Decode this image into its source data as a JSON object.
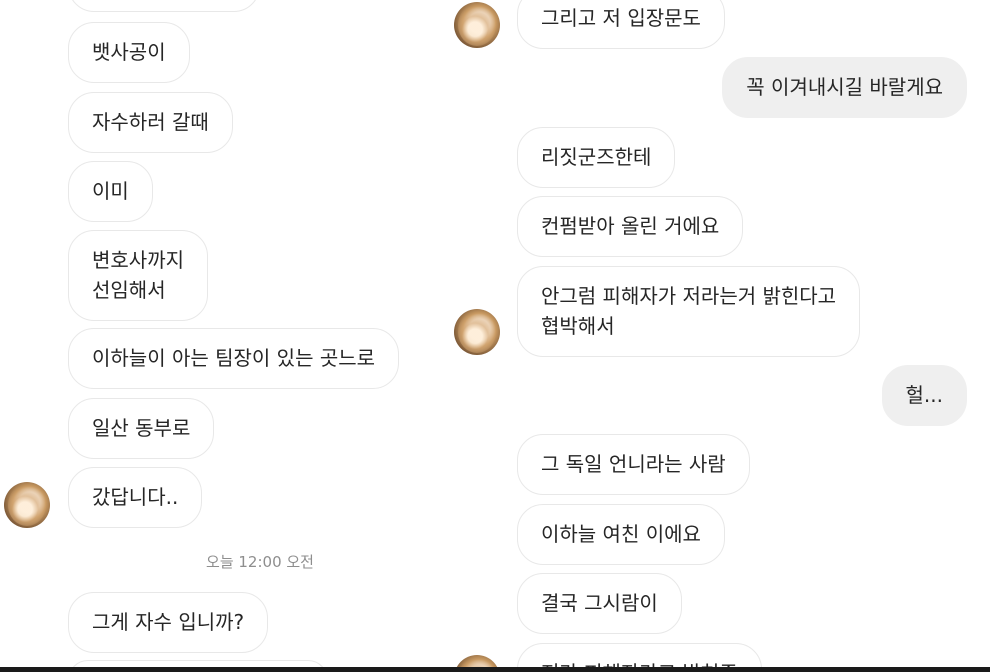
{
  "left_thread": {
    "messages": [
      {
        "text": "뱃사공이"
      },
      {
        "text": "자수하러 갈때"
      },
      {
        "text": "이미"
      },
      {
        "text": "변호사까지 선임해서",
        "line1": "변호사까지",
        "line2": "선임해서"
      },
      {
        "text": "이하늘이 아는 팀장이 있는 곳느로"
      },
      {
        "text": "일산 동부로"
      },
      {
        "text": "갔답니다.."
      },
      {
        "text": "그게 자수 입니까?"
      }
    ],
    "timestamp": "오늘 12:00 오전"
  },
  "right_thread": {
    "messages": [
      {
        "text": "그리고 저 입장문도",
        "direction": "received"
      },
      {
        "text": "꼭 이겨내시길 바랄게요",
        "direction": "sent"
      },
      {
        "text": "리짓군즈한테",
        "direction": "received"
      },
      {
        "text": "컨펌받아 올린 거에요",
        "direction": "received"
      },
      {
        "text": "안그럼 피해자가 저라는거 밝힌다고 협박해서",
        "line1": "안그럼 피해자가 저라는거 밝힌다고",
        "line2": "협박해서",
        "direction": "received"
      },
      {
        "text": "헐...",
        "direction": "sent"
      },
      {
        "text": "그 독일 언니라는 사람",
        "direction": "received"
      },
      {
        "text": "이하늘 여친 이에요",
        "direction": "received"
      },
      {
        "text": "결국 그시람이",
        "direction": "received"
      },
      {
        "text": "저라 피해자라고 밝혀주",
        "direction": "received"
      }
    ]
  },
  "colors": {
    "background": "#ffffff",
    "received_bubble": "#ffffff",
    "received_border": "#e8e8e8",
    "sent_bubble": "#efefef",
    "text": "#262626",
    "timestamp": "#8e8e8e"
  },
  "icons": {
    "avatar": "profile-avatar"
  }
}
